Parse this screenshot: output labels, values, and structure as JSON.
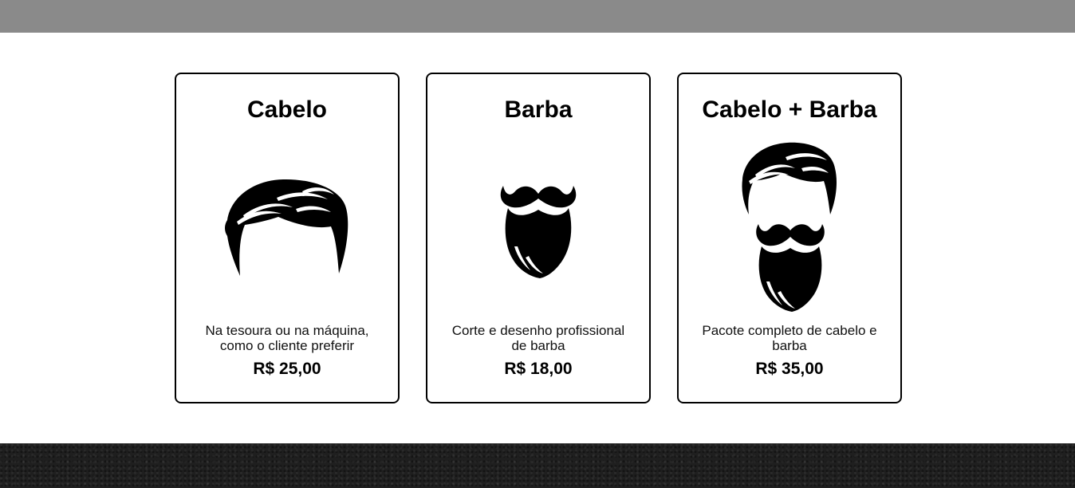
{
  "services": [
    {
      "title": "Cabelo",
      "icon": "hair-icon",
      "description": "Na tesoura ou na máquina, como o cliente preferir",
      "price": "R$ 25,00"
    },
    {
      "title": "Barba",
      "icon": "beard-icon",
      "description": "Corte e desenho profissional de barba",
      "price": "R$ 18,00"
    },
    {
      "title": "Cabelo + Barba",
      "icon": "hair-and-beard-icon",
      "description": "Pacote completo de cabelo e barba",
      "price": "R$ 35,00"
    }
  ],
  "colors": {
    "top_bar": "#8a8a8a",
    "footer": "#1f1f1f",
    "card_border": "#000000"
  }
}
